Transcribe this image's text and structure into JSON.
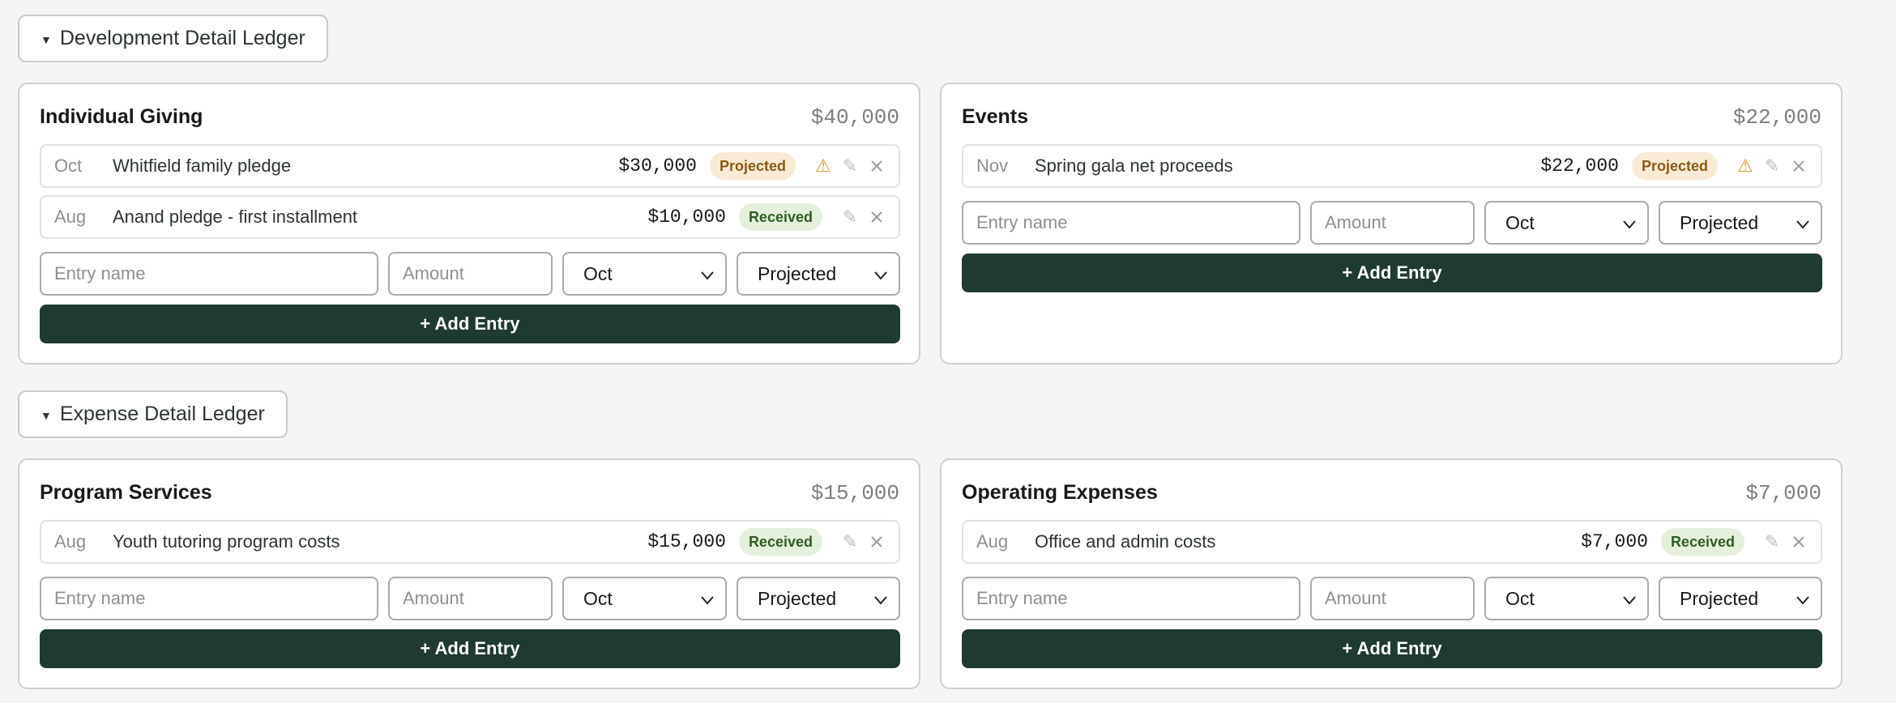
{
  "development": {
    "toggle_label": "Development Detail Ledger",
    "cards": [
      {
        "title": "Individual Giving",
        "total": "$40,000",
        "entries": [
          {
            "month": "Oct",
            "name": "Whitfield family pledge",
            "amount": "$30,000",
            "status": "Projected",
            "warning": true
          },
          {
            "month": "Aug",
            "name": "Anand pledge - first installment",
            "amount": "$10,000",
            "status": "Received",
            "warning": false
          }
        ],
        "form": {
          "name_placeholder": "Entry name",
          "amount_placeholder": "Amount",
          "month": "Oct",
          "status": "Projected"
        },
        "add_label": "+ Add Entry"
      },
      {
        "title": "Events",
        "total": "$22,000",
        "entries": [
          {
            "month": "Nov",
            "name": "Spring gala net proceeds",
            "amount": "$22,000",
            "status": "Projected",
            "warning": true
          }
        ],
        "form": {
          "name_placeholder": "Entry name",
          "amount_placeholder": "Amount",
          "month": "Oct",
          "status": "Projected"
        },
        "add_label": "+ Add Entry"
      }
    ]
  },
  "expense": {
    "toggle_label": "Expense Detail Ledger",
    "cards": [
      {
        "title": "Program Services",
        "total": "$15,000",
        "entries": [
          {
            "month": "Aug",
            "name": "Youth tutoring program costs",
            "amount": "$15,000",
            "status": "Received",
            "warning": false
          }
        ],
        "form": {
          "name_placeholder": "Entry name",
          "amount_placeholder": "Amount",
          "month": "Oct",
          "status": "Projected"
        },
        "add_label": "+ Add Entry"
      },
      {
        "title": "Operating Expenses",
        "total": "$7,000",
        "entries": [
          {
            "month": "Aug",
            "name": "Office and admin costs",
            "amount": "$7,000",
            "status": "Received",
            "warning": false
          }
        ],
        "form": {
          "name_placeholder": "Entry name",
          "amount_placeholder": "Amount",
          "month": "Oct",
          "status": "Projected"
        },
        "add_label": "+ Add Entry"
      }
    ]
  },
  "colors": {
    "button_bg": "#1f3a30",
    "projected_bg": "#f8ead5",
    "received_bg": "#e5f0dc",
    "warning": "#d49a22"
  },
  "icons": {
    "toggle": "caret-down-icon",
    "warning": "warning-icon",
    "edit": "pencil-icon",
    "remove": "close-icon",
    "select": "chevron-down-icon"
  }
}
